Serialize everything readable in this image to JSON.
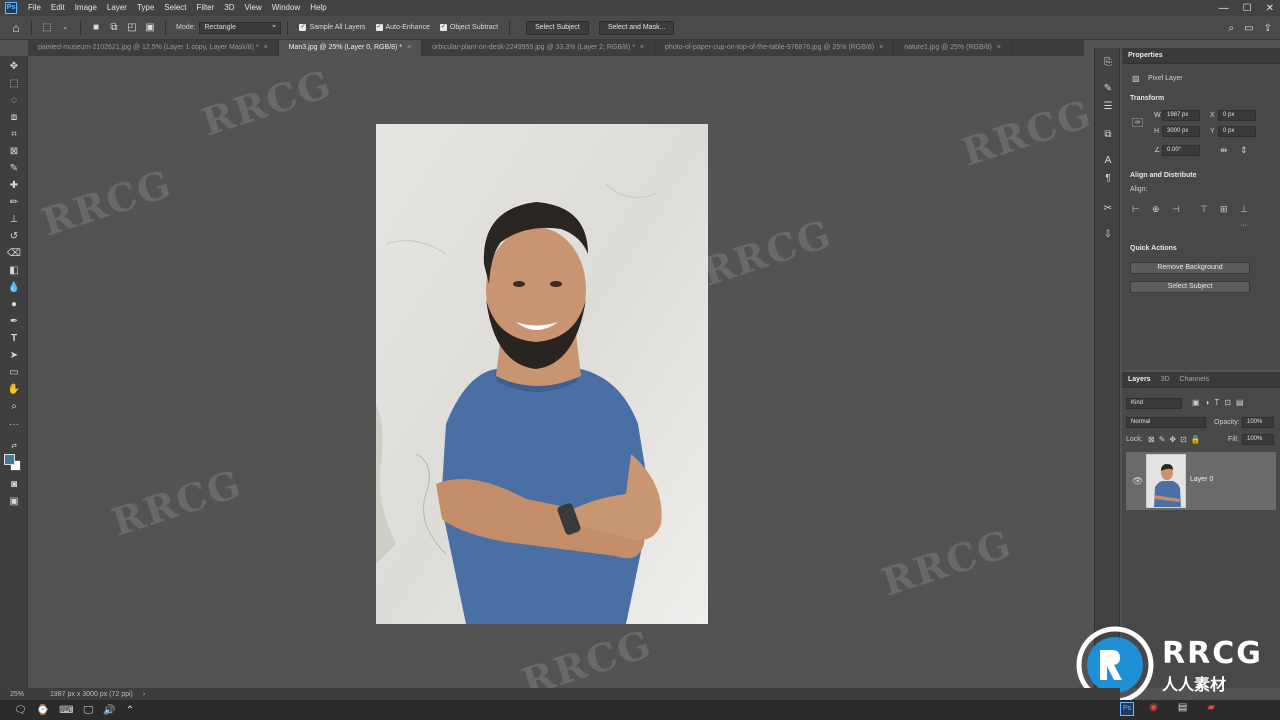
{
  "app": {
    "logo": "Ps"
  },
  "menu": [
    "File",
    "Edit",
    "Image",
    "Layer",
    "Type",
    "Select",
    "Filter",
    "3D",
    "View",
    "Window",
    "Help"
  ],
  "options": {
    "mode_label": "Mode:",
    "mode_value": "Rectangle",
    "sample_all_layers": "Sample All Layers",
    "auto_enhance": "Auto-Enhance",
    "object_subtract": "Object Subtract",
    "select_subject": "Select Subject",
    "select_and_mask": "Select and Mask..."
  },
  "tabs": [
    {
      "label": "painted-museum-2102621.jpg @ 12.5% (Layer 1 copy, Layer Mask/8) *",
      "active": false
    },
    {
      "label": "Man3.jpg @ 25% (Layer 0, RGB/8) *",
      "active": true
    },
    {
      "label": "orbicular-plant-on-desk-2249959.jpg @ 33.3% (Layer 2, RGB/8) *",
      "active": false
    },
    {
      "label": "photo-of-paper-cup-on-top-of-the-table-976876.jpg @ 25% (RGB/8)",
      "active": false
    },
    {
      "label": "nature1.jpg @ 25% (RGB/8)",
      "active": false
    }
  ],
  "properties": {
    "title": "Properties",
    "layer_type": "Pixel Layer",
    "transform_title": "Transform",
    "w_label": "W",
    "w_value": "1987 px",
    "h_label": "H",
    "h_value": "3000 px",
    "x_label": "X",
    "x_value": "0 px",
    "y_label": "Y",
    "y_value": "0 px",
    "angle_value": "0.00°",
    "align_title": "Align and Distribute",
    "align_label": "Align:",
    "quick_actions_title": "Quick Actions",
    "remove_background": "Remove Background",
    "select_subject": "Select Subject"
  },
  "layers": {
    "tabs": [
      "Layers",
      "3D",
      "Channels"
    ],
    "kind": "Kind",
    "blend_mode": "Normal",
    "opacity_label": "Opacity:",
    "opacity_value": "100%",
    "lock_label": "Lock:",
    "fill_label": "Fill:",
    "fill_value": "100%",
    "layer_name": "Layer 0"
  },
  "status": {
    "zoom": "25%",
    "doc_info": "1987 px x 3000 px (72 ppi)"
  },
  "watermark": {
    "text": "RRCG",
    "logo_text": "RRCG",
    "logo_sub": "人人素材"
  },
  "colors": {
    "accent_blue": "#3d7a9e",
    "shirt_blue": "#4a6fa5",
    "panel": "#484848"
  }
}
